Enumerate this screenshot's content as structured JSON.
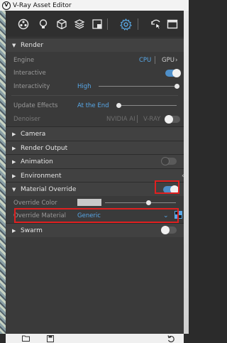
{
  "window": {
    "title": "V-Ray Asset Editor"
  },
  "toolbar": {
    "icons": [
      "materials-icon",
      "lights-icon",
      "geometry-icon",
      "layers-icon",
      "render-elements-icon",
      "settings-icon",
      "render-interactive-icon",
      "frame-buffer-icon"
    ]
  },
  "render": {
    "header": "Render",
    "engine_label": "Engine",
    "engine_cpu": "CPU",
    "engine_gpu": "GPU",
    "interactive_label": "Interactive",
    "interactive_on": true,
    "interactivity_label": "Interactivity",
    "interactivity_value": "High",
    "update_effects_label": "Update Effects",
    "update_effects_value": "At the End",
    "denoiser_label": "Denoiser",
    "denoiser_nvidia": "NVIDIA AI",
    "denoiser_vray": "V-RAY",
    "denoiser_on": false
  },
  "sections": {
    "camera": "Camera",
    "render_output": "Render Output",
    "animation": "Animation",
    "environment": "Environment",
    "material_override": "Material Override",
    "swarm": "Swarm"
  },
  "material_override": {
    "enabled": true,
    "override_color_label": "Override Color",
    "override_material_label": "Override Material",
    "override_material_value": "Generic"
  },
  "animation_on": false,
  "swarm_on": false,
  "colors": {
    "accent": "#58a8e8",
    "highlight": "#e02020",
    "toggle_on": "#4e8fc9"
  }
}
